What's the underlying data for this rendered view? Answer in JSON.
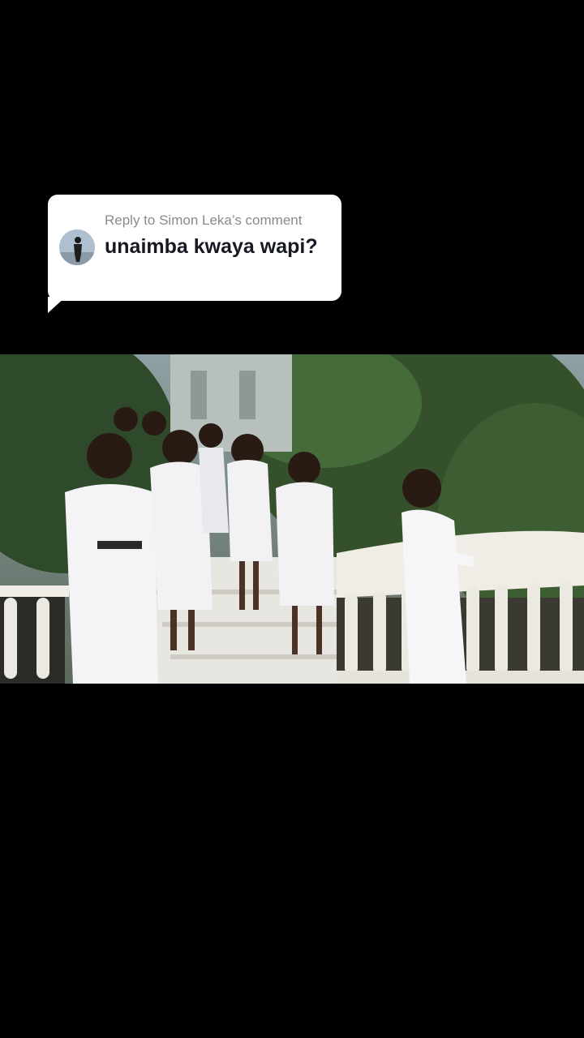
{
  "reply_card": {
    "header": "Reply to Simon Leka’s comment",
    "comment_text": "unaimba kwaya wapi?",
    "avatar_icon": "user-avatar"
  },
  "video": {
    "description_icon": "choir-video-frame"
  }
}
